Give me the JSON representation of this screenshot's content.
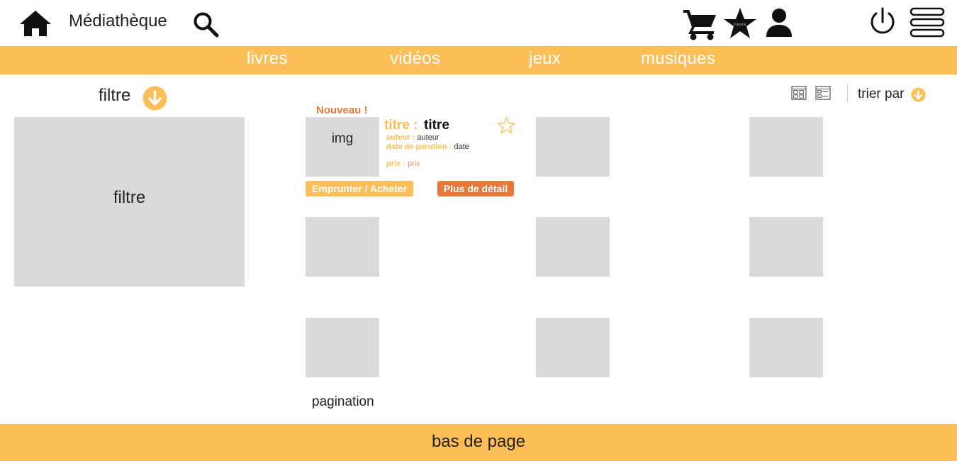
{
  "header": {
    "brand": "Médiathèque",
    "icons": [
      "home-icon",
      "search-icon",
      "cart-icon",
      "star-icon",
      "user-icon",
      "power-icon",
      "menu-icon"
    ],
    "star_icon_caption": "Favoris"
  },
  "nav": {
    "items": [
      {
        "label": "livres"
      },
      {
        "label": "vidéos"
      },
      {
        "label": "jeux"
      },
      {
        "label": "musiques"
      }
    ]
  },
  "filter": {
    "title": "filtre",
    "box_label": "filtre"
  },
  "sort": {
    "label": "trier par"
  },
  "product": {
    "badge": "Nouveau !",
    "img_label": "img",
    "title_label": "titre :",
    "title_value": "titre",
    "author_label": "auteur :",
    "author_value": "auteur",
    "date_label": "date de parution :",
    "date_value": "date",
    "price_label": "prix :",
    "price_value": "prix",
    "borrow_button": "Emprunter / Acheter",
    "detail_button": "Plus de détail"
  },
  "pagination": "pagination",
  "footer": "bas de page",
  "colors": {
    "accent": "#fdbe58",
    "accent_dark": "#e8773a",
    "placeholder": "#d9d9d9"
  }
}
